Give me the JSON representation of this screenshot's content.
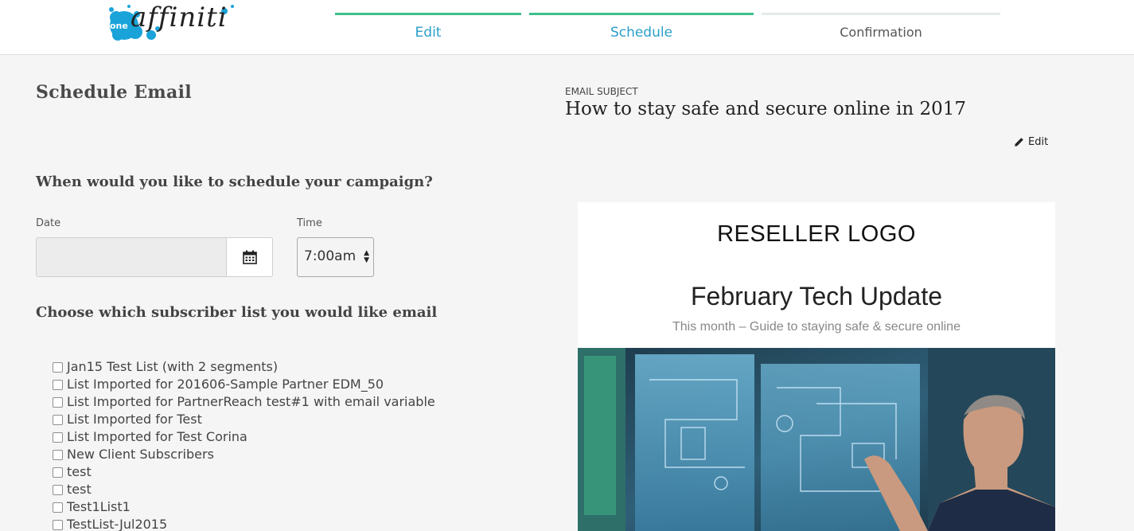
{
  "brand": {
    "logo_text": "affiniti",
    "logo_prefix": "one"
  },
  "steps": [
    {
      "label": "Edit",
      "state": "done"
    },
    {
      "label": "Schedule",
      "state": "current"
    },
    {
      "label": "Confirmation",
      "state": "todo"
    }
  ],
  "page": {
    "title": "Schedule Email"
  },
  "subject": {
    "label": "EMAIL SUBJECT",
    "text": "How to stay safe and secure online in 2017",
    "edit_label": "Edit"
  },
  "schedule": {
    "question": "When would you like to schedule your campaign?",
    "date_label": "Date",
    "date_value": "",
    "time_label": "Time",
    "time_value": "7:00am",
    "calendar_icon": "calendar-icon"
  },
  "subscribers": {
    "question": "Choose which subscriber list you would like email",
    "lists": [
      {
        "label": "Jan15 Test List (with 2 segments)",
        "checked": false
      },
      {
        "label": "List Imported for 201606-Sample Partner EDM_50",
        "checked": false
      },
      {
        "label": "List Imported for PartnerReach test#1 with email variable",
        "checked": false
      },
      {
        "label": "List Imported for Test",
        "checked": false
      },
      {
        "label": "List Imported for Test Corina",
        "checked": false
      },
      {
        "label": "New Client Subscribers",
        "checked": false
      },
      {
        "label": "test",
        "checked": false
      },
      {
        "label": "test",
        "checked": false
      },
      {
        "label": "Test1List1",
        "checked": false
      },
      {
        "label": "TestList-Jul2015",
        "checked": false
      }
    ]
  },
  "preview": {
    "logo_text": "RESELLER LOGO",
    "title": "February Tech Update",
    "subtitle": "This month – Guide to staying safe & secure online"
  },
  "colors": {
    "accent_green": "#3ec08b",
    "accent_blue": "#2a9fc9",
    "logo_blue": "#1aa3d9"
  }
}
